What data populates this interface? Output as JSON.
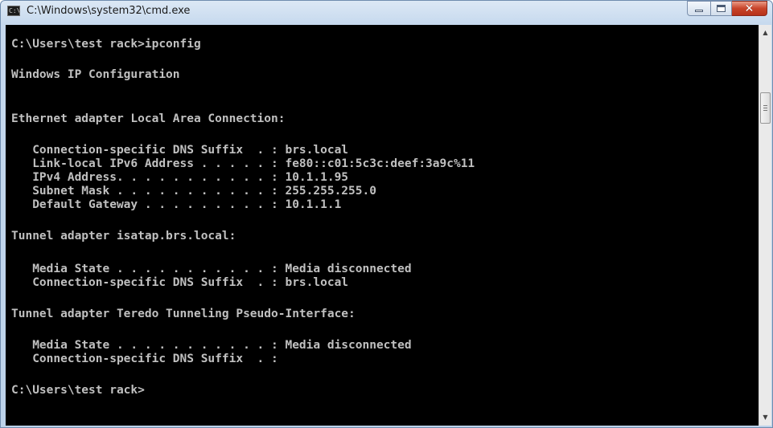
{
  "window": {
    "title": "C:\\Windows\\system32\\cmd.exe",
    "icon_name": "cmd-icon",
    "icon_text": "C:\\"
  },
  "controls": {
    "minimize_icon": "minimize-icon",
    "maximize_icon": "maximize-icon",
    "close_icon": "close-icon",
    "close_glyph": "✕"
  },
  "console": {
    "background": "#000000",
    "foreground": "#c0c0c0",
    "lines": [
      "C:\\Users\\test rack>ipconfig",
      "Windows IP Configuration",
      "Ethernet adapter Local Area Connection:",
      "   Connection-specific DNS Suffix  . : brs.local",
      "   Link-local IPv6 Address . . . . . : fe80::c01:5c3c:deef:3a9c%11",
      "   IPv4 Address. . . . . . . . . . . : 10.1.1.95",
      "   Subnet Mask . . . . . . . . . . . : 255.255.255.0",
      "   Default Gateway . . . . . . . . . : 10.1.1.1",
      "Tunnel adapter isatap.brs.local:",
      "   Media State . . . . . . . . . . . : Media disconnected",
      "   Connection-specific DNS Suffix  . : brs.local",
      "Tunnel adapter Teredo Tunneling Pseudo-Interface:",
      "   Media State . . . . . . . . . . . : Media disconnected",
      "   Connection-specific DNS Suffix  . :",
      "C:\\Users\\test rack>"
    ]
  },
  "scrollbar": {
    "up_arrow": "▲",
    "down_arrow": "▼"
  }
}
